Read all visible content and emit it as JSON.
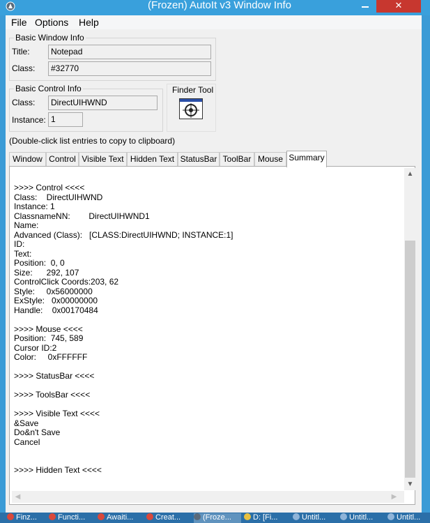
{
  "window_title": "(Frozen) AutoIt v3 Window Info",
  "close_glyph": "✕",
  "menu": [
    "File",
    "Options",
    "Help"
  ],
  "basic_window": {
    "legend": "Basic Window Info",
    "title_label": "Title:",
    "title_value": "Notepad",
    "class_label": "Class:",
    "class_value": "#32770"
  },
  "basic_control": {
    "legend": "Basic Control Info",
    "class_label": "Class:",
    "class_value": "DirectUIHWND",
    "instance_label": "Instance:",
    "instance_value": "1"
  },
  "finder_tool": {
    "label": "Finder Tool",
    "icon": "crosshair-target-icon"
  },
  "hint": "(Double-click list entries to copy to clipboard)",
  "tabs": [
    "Window",
    "Control",
    "Visible Text",
    "Hidden Text",
    "StatusBar",
    "ToolBar",
    "Mouse",
    "Summary"
  ],
  "active_tab": "Summary",
  "summary_lines": [
    ">>>> Control <<<<",
    "Class:    DirectUIHWND",
    "Instance: 1",
    "ClassnameNN:        DirectUIHWND1",
    "Name:",
    "Advanced (Class):   [CLASS:DirectUIHWND; INSTANCE:1]",
    "ID:",
    "Text:",
    "Position:  0, 0",
    "Size:      292, 107",
    "ControlClick Coords:203, 62",
    "Style:     0x56000000",
    "ExStyle:   0x00000000",
    "Handle:    0x00170484",
    "",
    ">>>> Mouse <<<<",
    "Position:  745, 589",
    "Cursor ID:2",
    "Color:     0xFFFFFF",
    "",
    ">>>> StatusBar <<<<",
    "",
    ">>>> ToolsBar <<<<",
    "",
    ">>>> Visible Text <<<<",
    "&Save",
    "Do&n't Save",
    "Cancel",
    "",
    "",
    ">>>> Hidden Text <<<<"
  ],
  "taskbar": [
    "Finz...",
    "Functi...",
    "Awaiti...",
    "Creat...",
    "(Froze...",
    "D: [Fi...",
    "Untitl...",
    "Untitl...",
    "Untitl..."
  ],
  "colors": {
    "titlebar": "#39a0dc",
    "close_button": "#c7372f",
    "taskbar": "#2b6fa8"
  }
}
